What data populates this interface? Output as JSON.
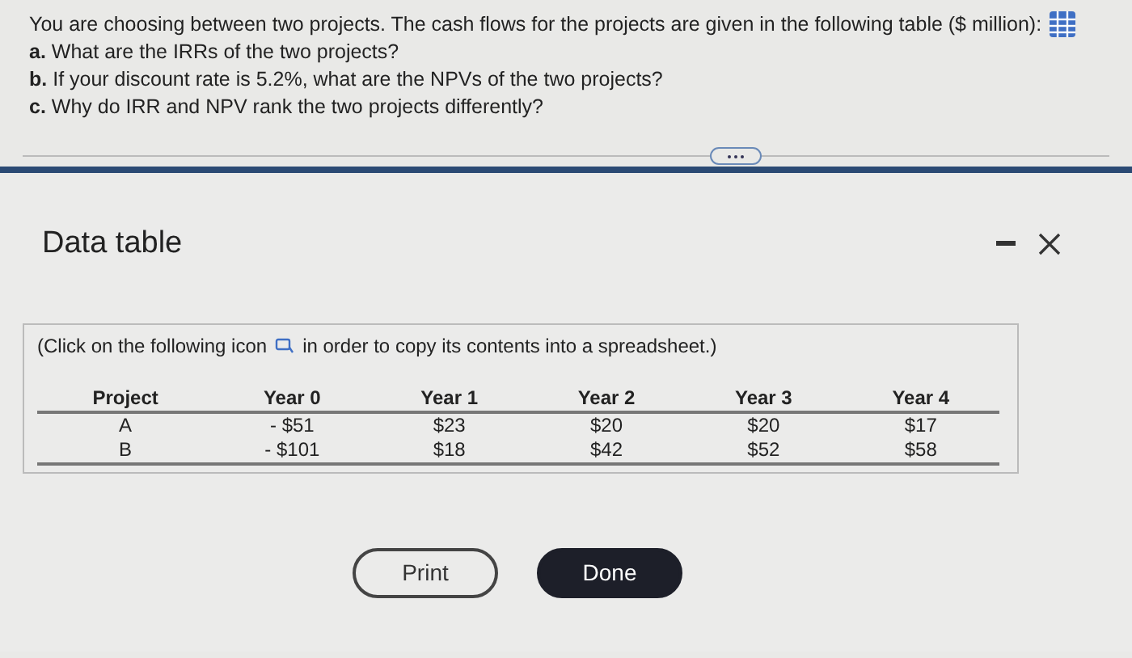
{
  "question": {
    "intro": "You are choosing between two projects. The cash flows for the projects are given in the following table ($ million):",
    "parts": [
      {
        "letter": "a.",
        "text": "What are the IRRs of the two projects?"
      },
      {
        "letter": "b.",
        "text": "If your discount rate is 5.2%, what are the NPVs of the two projects?"
      },
      {
        "letter": "c.",
        "text": "Why do IRR and NPV rank the two projects differently?"
      }
    ]
  },
  "dialog": {
    "title": "Data table",
    "instruction_before": "(Click on the following icon",
    "instruction_after": "in order to copy its contents into a spreadsheet.)",
    "table": {
      "columns": [
        "Project",
        "Year 0",
        "Year 1",
        "Year 2",
        "Year 3",
        "Year 4"
      ],
      "rows": [
        [
          "A",
          "- $51",
          "$23",
          "$20",
          "$20",
          "$17"
        ],
        [
          "B",
          "- $101",
          "$18",
          "$42",
          "$52",
          "$58"
        ]
      ]
    },
    "buttons": [
      {
        "label": "Print",
        "kind": "outline"
      },
      {
        "label": "Done",
        "kind": "filled"
      }
    ]
  }
}
